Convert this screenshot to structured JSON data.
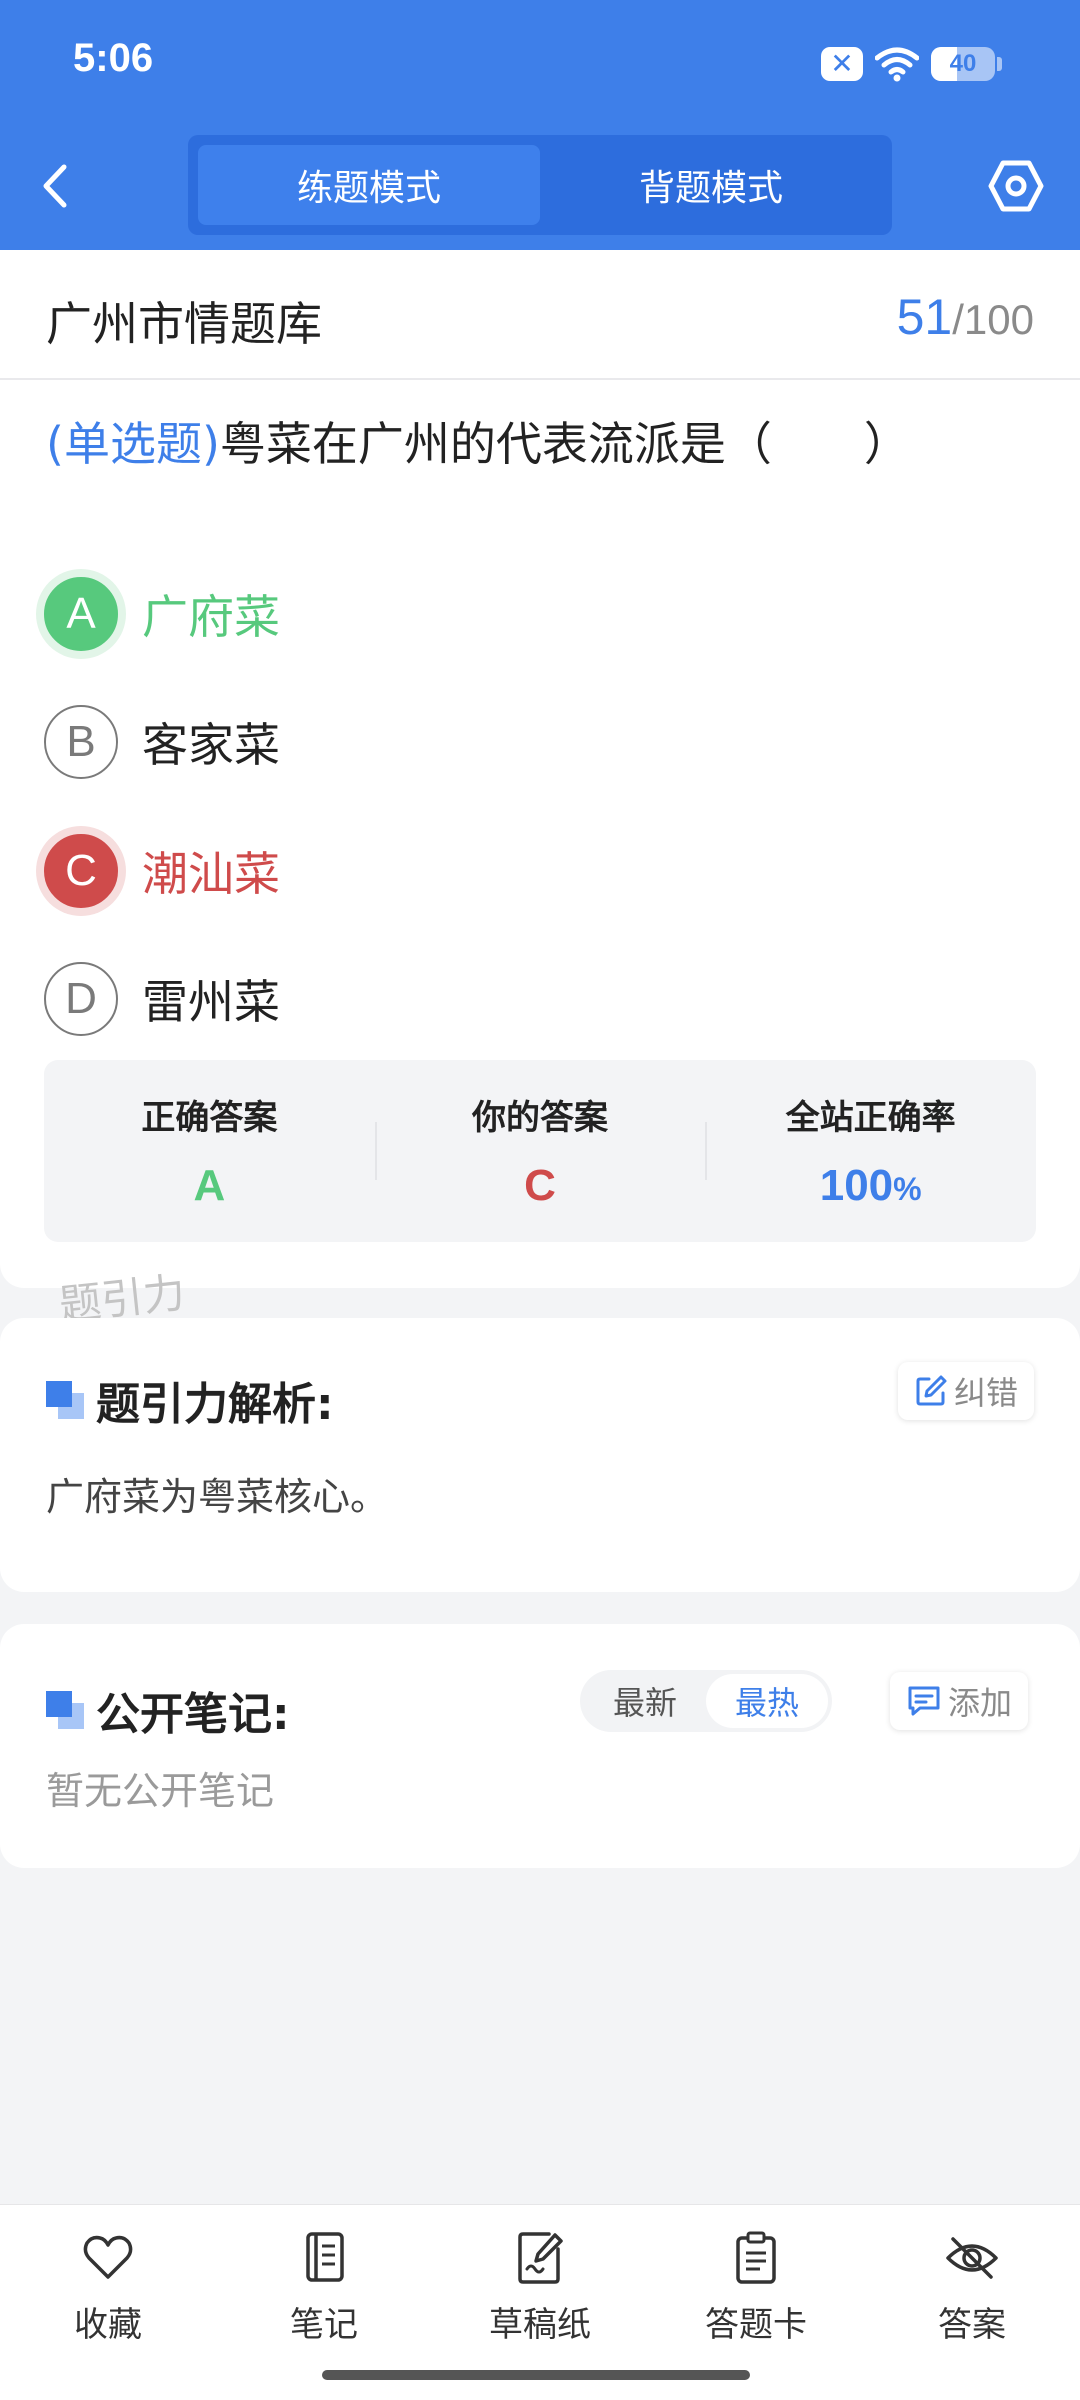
{
  "status_bar": {
    "time": "5:06",
    "battery": 40
  },
  "header": {
    "tabs": [
      {
        "label": "练题模式",
        "active": true
      },
      {
        "label": "背题模式",
        "active": false
      }
    ],
    "back_icon": "chevron-left-icon",
    "settings_icon": "hexagon-gear-icon"
  },
  "question_bank": {
    "title": "广州市情题库",
    "current": "51",
    "separator": "/",
    "total": "100"
  },
  "question": {
    "type": "(单选题)",
    "text": "粤菜在广州的代表流派是（　　）",
    "options": [
      {
        "letter": "A",
        "text": "广府菜",
        "state": "correct"
      },
      {
        "letter": "B",
        "text": "客家菜",
        "state": "normal"
      },
      {
        "letter": "C",
        "text": "潮汕菜",
        "state": "wrong"
      },
      {
        "letter": "D",
        "text": "雷州菜",
        "state": "normal"
      }
    ]
  },
  "answer_summary": {
    "correct_label": "正确答案",
    "correct_value": "A",
    "your_label": "你的答案",
    "your_value": "C",
    "rate_label": "全站正确率",
    "rate_value": "100",
    "rate_unit": "%"
  },
  "watermark": "题引力",
  "analysis": {
    "title": "题引力解析:",
    "correct_button": "纠错",
    "text": "广府菜为粤菜核心。"
  },
  "notes": {
    "title": "公开笔记:",
    "sort_options": [
      {
        "label": "最新",
        "active": false
      },
      {
        "label": "最热",
        "active": true
      }
    ],
    "add_button": "添加",
    "empty_text": "暂无公开笔记"
  },
  "bottom_nav": [
    {
      "label": "收藏",
      "icon": "heart-icon"
    },
    {
      "label": "笔记",
      "icon": "notebook-icon"
    },
    {
      "label": "草稿纸",
      "icon": "draft-paper-icon"
    },
    {
      "label": "答题卡",
      "icon": "answer-sheet-icon"
    },
    {
      "label": "答案",
      "icon": "eye-off-icon"
    }
  ],
  "colors": {
    "primary": "#3e7fe9",
    "correct": "#57c97d",
    "wrong": "#cf4b4b",
    "background": "#f3f4f6"
  }
}
